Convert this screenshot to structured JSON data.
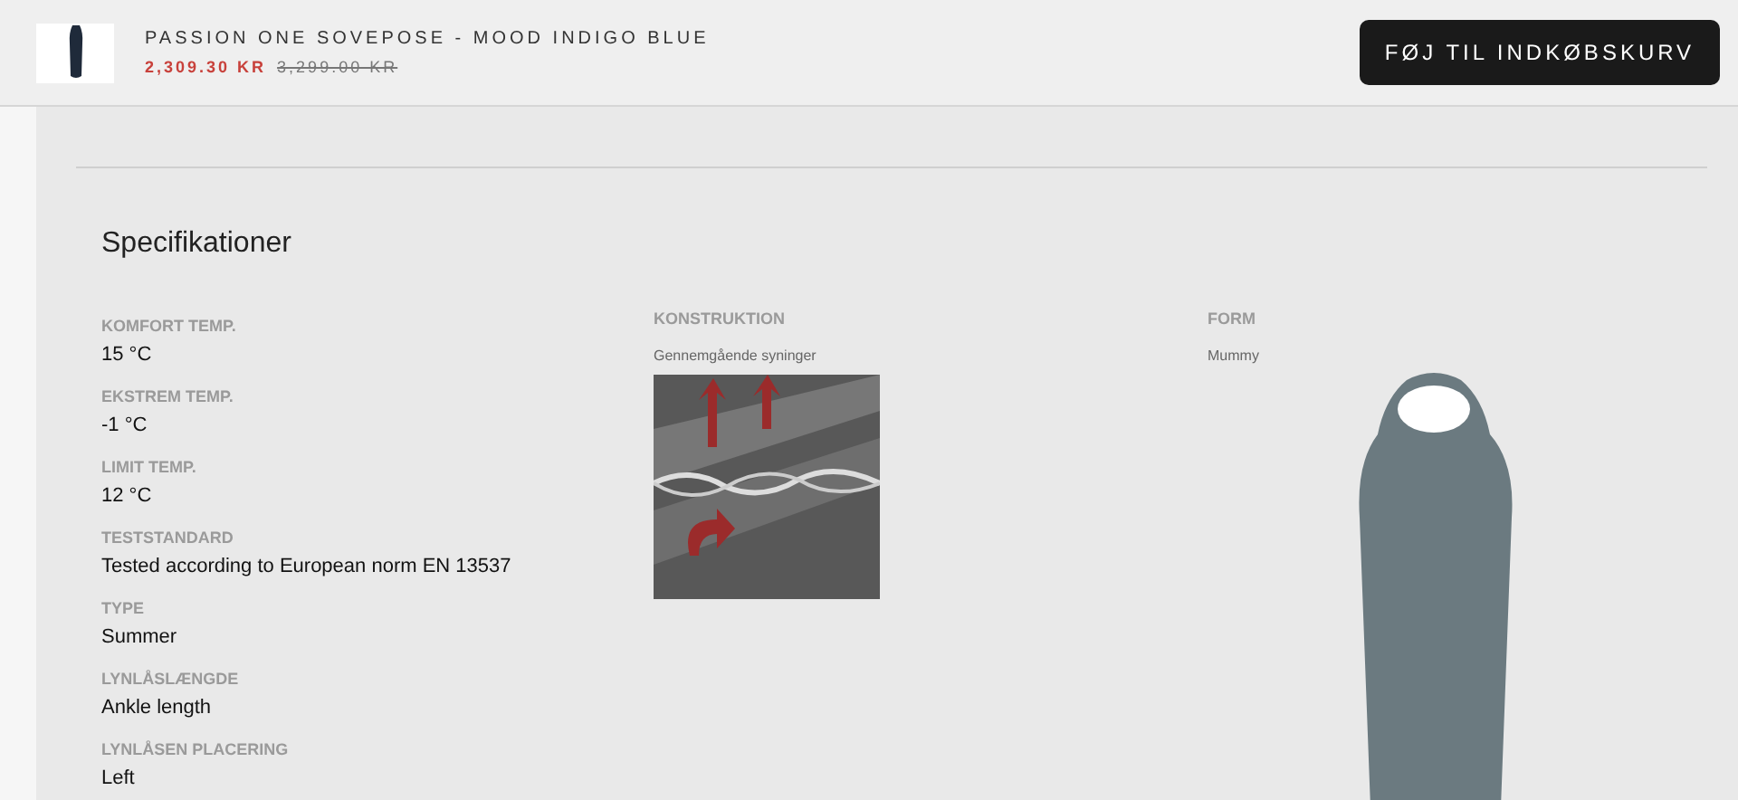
{
  "product_bar": {
    "title": "PASSION ONE SOVEPOSE - MOOD INDIGO BLUE",
    "sale_price": "2,309.30 KR",
    "original_price": "3,299.00 KR",
    "add_to_cart_button": "FØJ TIL INDKØBSKURV"
  },
  "specifications": {
    "heading": "Specifikationer",
    "items": [
      {
        "label": "KOMFORT TEMP.",
        "value": "15 °C"
      },
      {
        "label": "EKSTREM TEMP.",
        "value": "-1 °C"
      },
      {
        "label": "LIMIT TEMP.",
        "value": "12 °C"
      },
      {
        "label": "TESTSTANDARD",
        "value": "Tested according to European norm EN 13537"
      },
      {
        "label": "TYPE",
        "value": "Summer"
      },
      {
        "label": "LYNLÅSLÆNGDE",
        "value": "Ankle length"
      },
      {
        "label": "LYNLÅSEN PLACERING",
        "value": "Left"
      }
    ],
    "construction": {
      "label": "KONSTRUKTION",
      "value": "Gennemgående syninger"
    },
    "form": {
      "label": "FORM",
      "value": "Mummy"
    }
  }
}
